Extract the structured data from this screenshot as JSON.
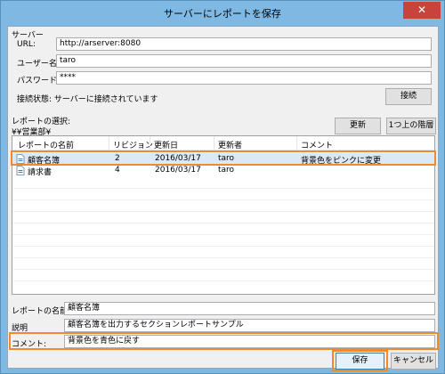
{
  "window": {
    "title": "サーバーにレポートを保存",
    "close_glyph": "✕"
  },
  "server": {
    "section_label": "サーバー",
    "url_label": "URL:",
    "url_value": "http://arserver:8080",
    "user_label": "ユーザー名:",
    "user_value": "taro",
    "password_label": "パスワード:",
    "password_value": "****",
    "status_text": "接続状態: サーバーに接続されています",
    "connect_button": "接続"
  },
  "report_select": {
    "label": "レポートの選択:",
    "path": "¥¥営業部¥",
    "refresh_button": "更新",
    "up_button": "1つ上の階層"
  },
  "list": {
    "columns": [
      "レポートの名前",
      "リビジョン",
      "更新日",
      "更新者",
      "コメント"
    ],
    "rows": [
      {
        "name": "顧客名簿",
        "revision": "2",
        "date": "2016/03/17",
        "updater": "taro",
        "comment": "背景色をピンクに変更",
        "icon": "report-document-icon"
      },
      {
        "name": "請求書",
        "revision": "4",
        "date": "2016/03/17",
        "updater": "taro",
        "comment": "",
        "icon": "report-document-icon"
      }
    ]
  },
  "form": {
    "name_label": "レポートの名前:",
    "name_value": "顧客名簿",
    "desc_label": "説明",
    "desc_value": "顧客名簿を出力するセクションレポートサンプル",
    "comment_label": "コメント:",
    "comment_value": "背景色を青色に戻す"
  },
  "buttons": {
    "save": "保存",
    "cancel": "キャンセル"
  },
  "colors": {
    "highlight": "#f08a2c",
    "titlebar": "#7fb8e3",
    "close": "#c7433b",
    "selection": "#dbe9f7"
  }
}
